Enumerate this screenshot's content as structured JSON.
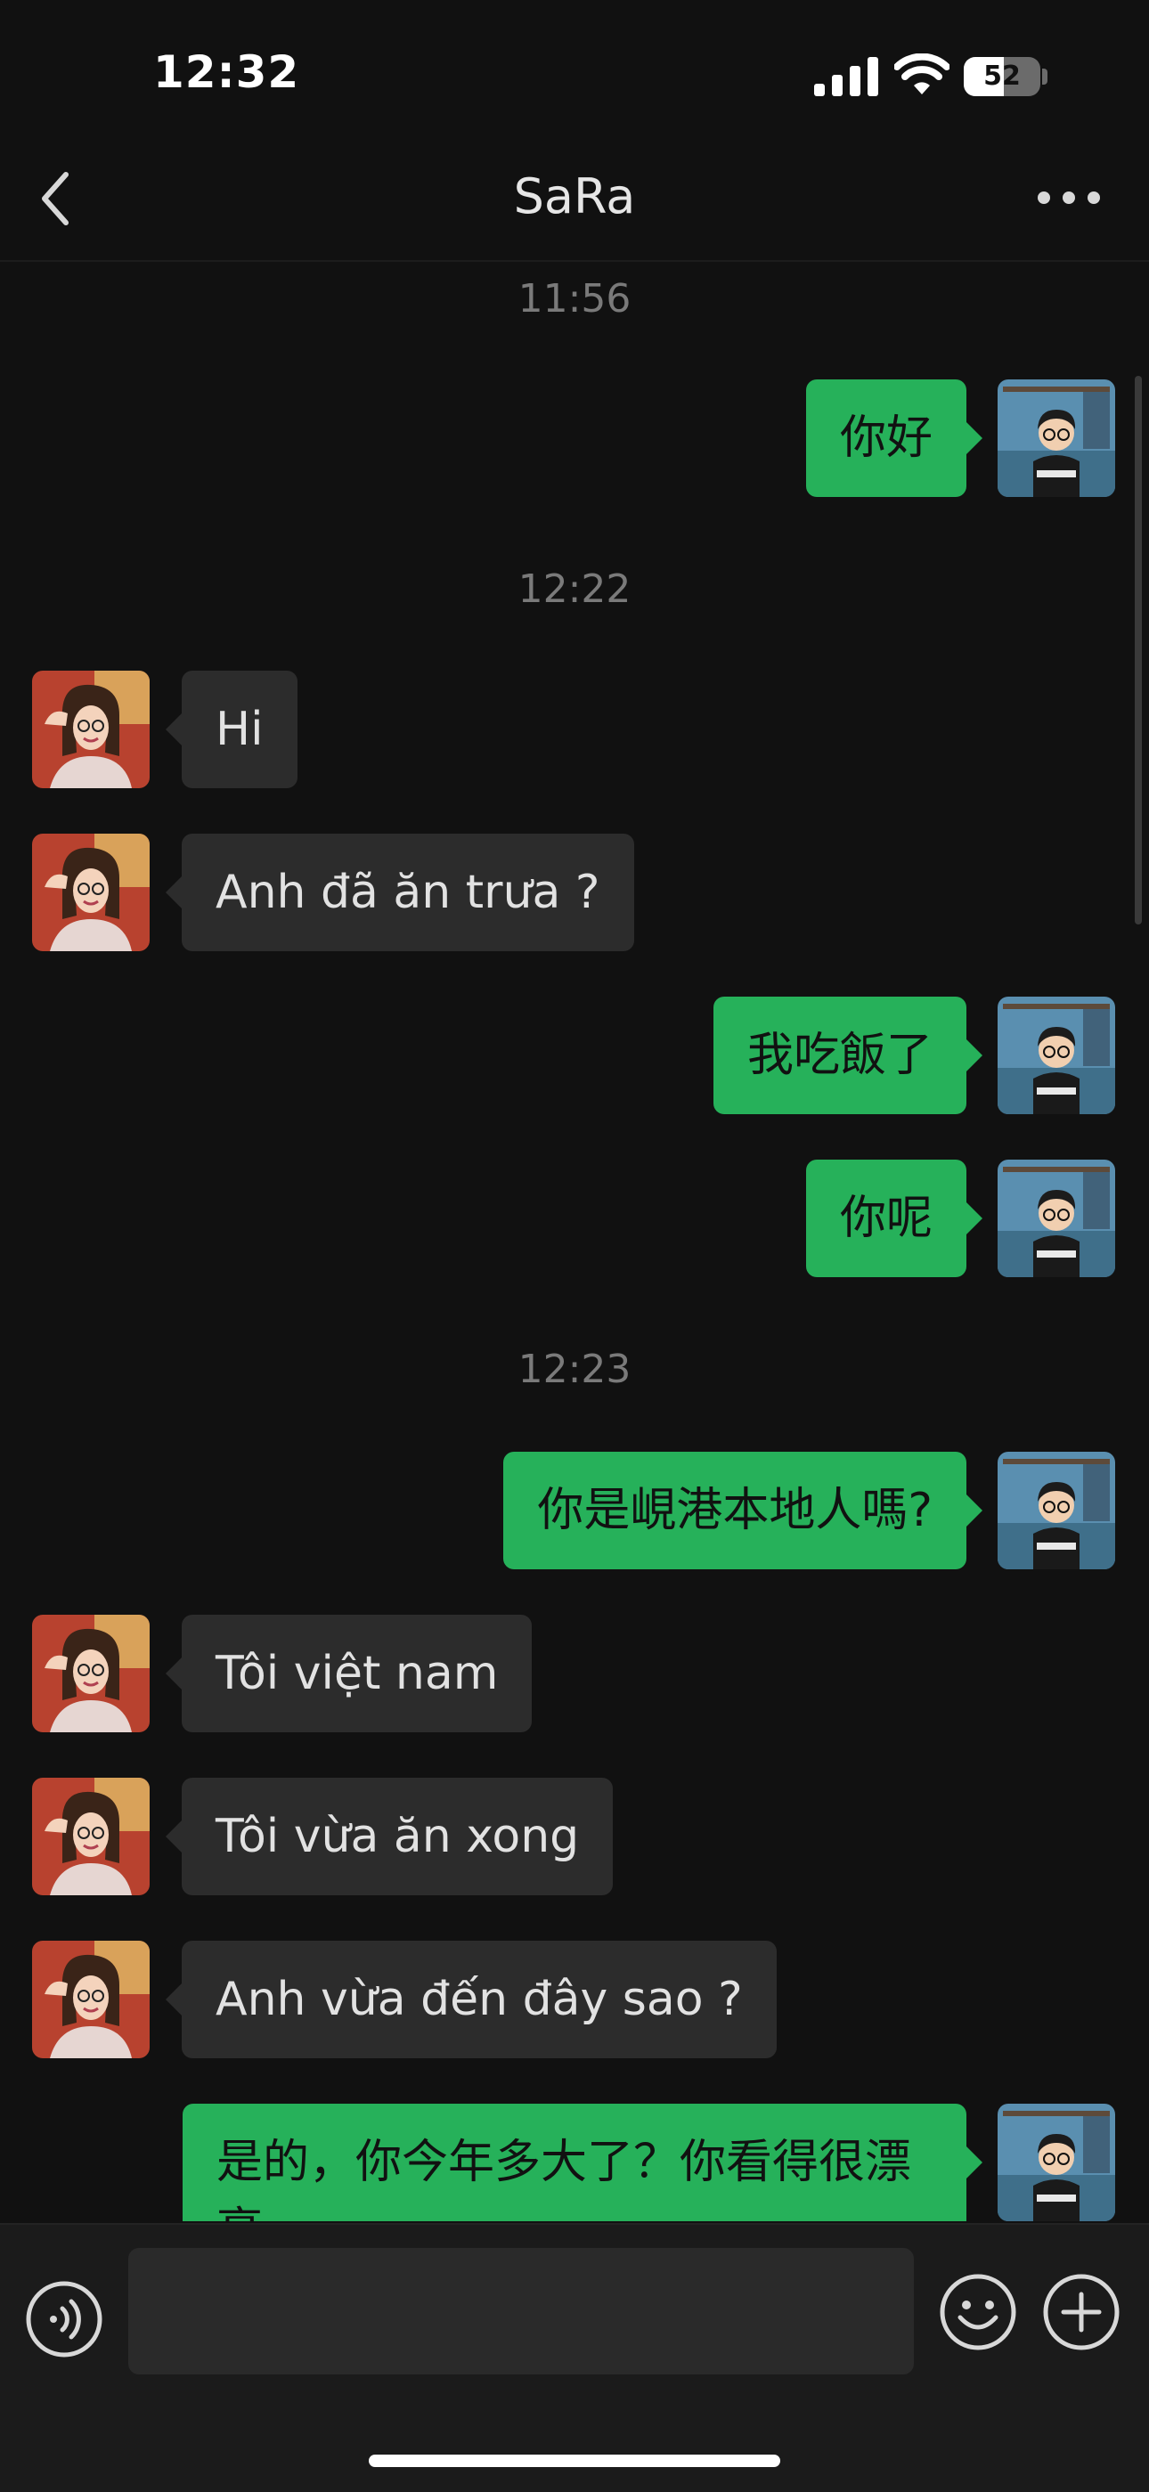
{
  "status_bar": {
    "time": "12:32",
    "battery_level": "52",
    "battery_fraction": 0.52
  },
  "header": {
    "title": "SaRa",
    "back_icon": "chevron-left-icon",
    "more_icon": "ellipsis-icon"
  },
  "chat": {
    "timestamps": [
      "11:56",
      "12:22",
      "12:23"
    ],
    "messages": [
      {
        "from": "me",
        "text": "你好"
      },
      {
        "from": "contact",
        "text": "Hi"
      },
      {
        "from": "contact",
        "text": "Anh đã ăn trưa ?"
      },
      {
        "from": "me",
        "text": "我吃飯了"
      },
      {
        "from": "me",
        "text": "你呢"
      },
      {
        "from": "me",
        "text": "你是峴港本地人嗎?"
      },
      {
        "from": "contact",
        "text": "Tôi việt nam"
      },
      {
        "from": "contact",
        "text": "Tôi vừa ăn xong"
      },
      {
        "from": "contact",
        "text": "Anh vừa đến đây sao ?"
      },
      {
        "from": "me",
        "text": "是的，你今年多大了？你看得很漂亮"
      }
    ]
  },
  "input_bar": {
    "voice_icon": "voice-icon",
    "message_value": "",
    "emoji_icon": "emoji-icon",
    "plus_icon": "plus-icon"
  },
  "colors": {
    "background": "#111111",
    "outgoing_bubble": "#26b15a",
    "incoming_bubble": "#2c2c2c"
  }
}
